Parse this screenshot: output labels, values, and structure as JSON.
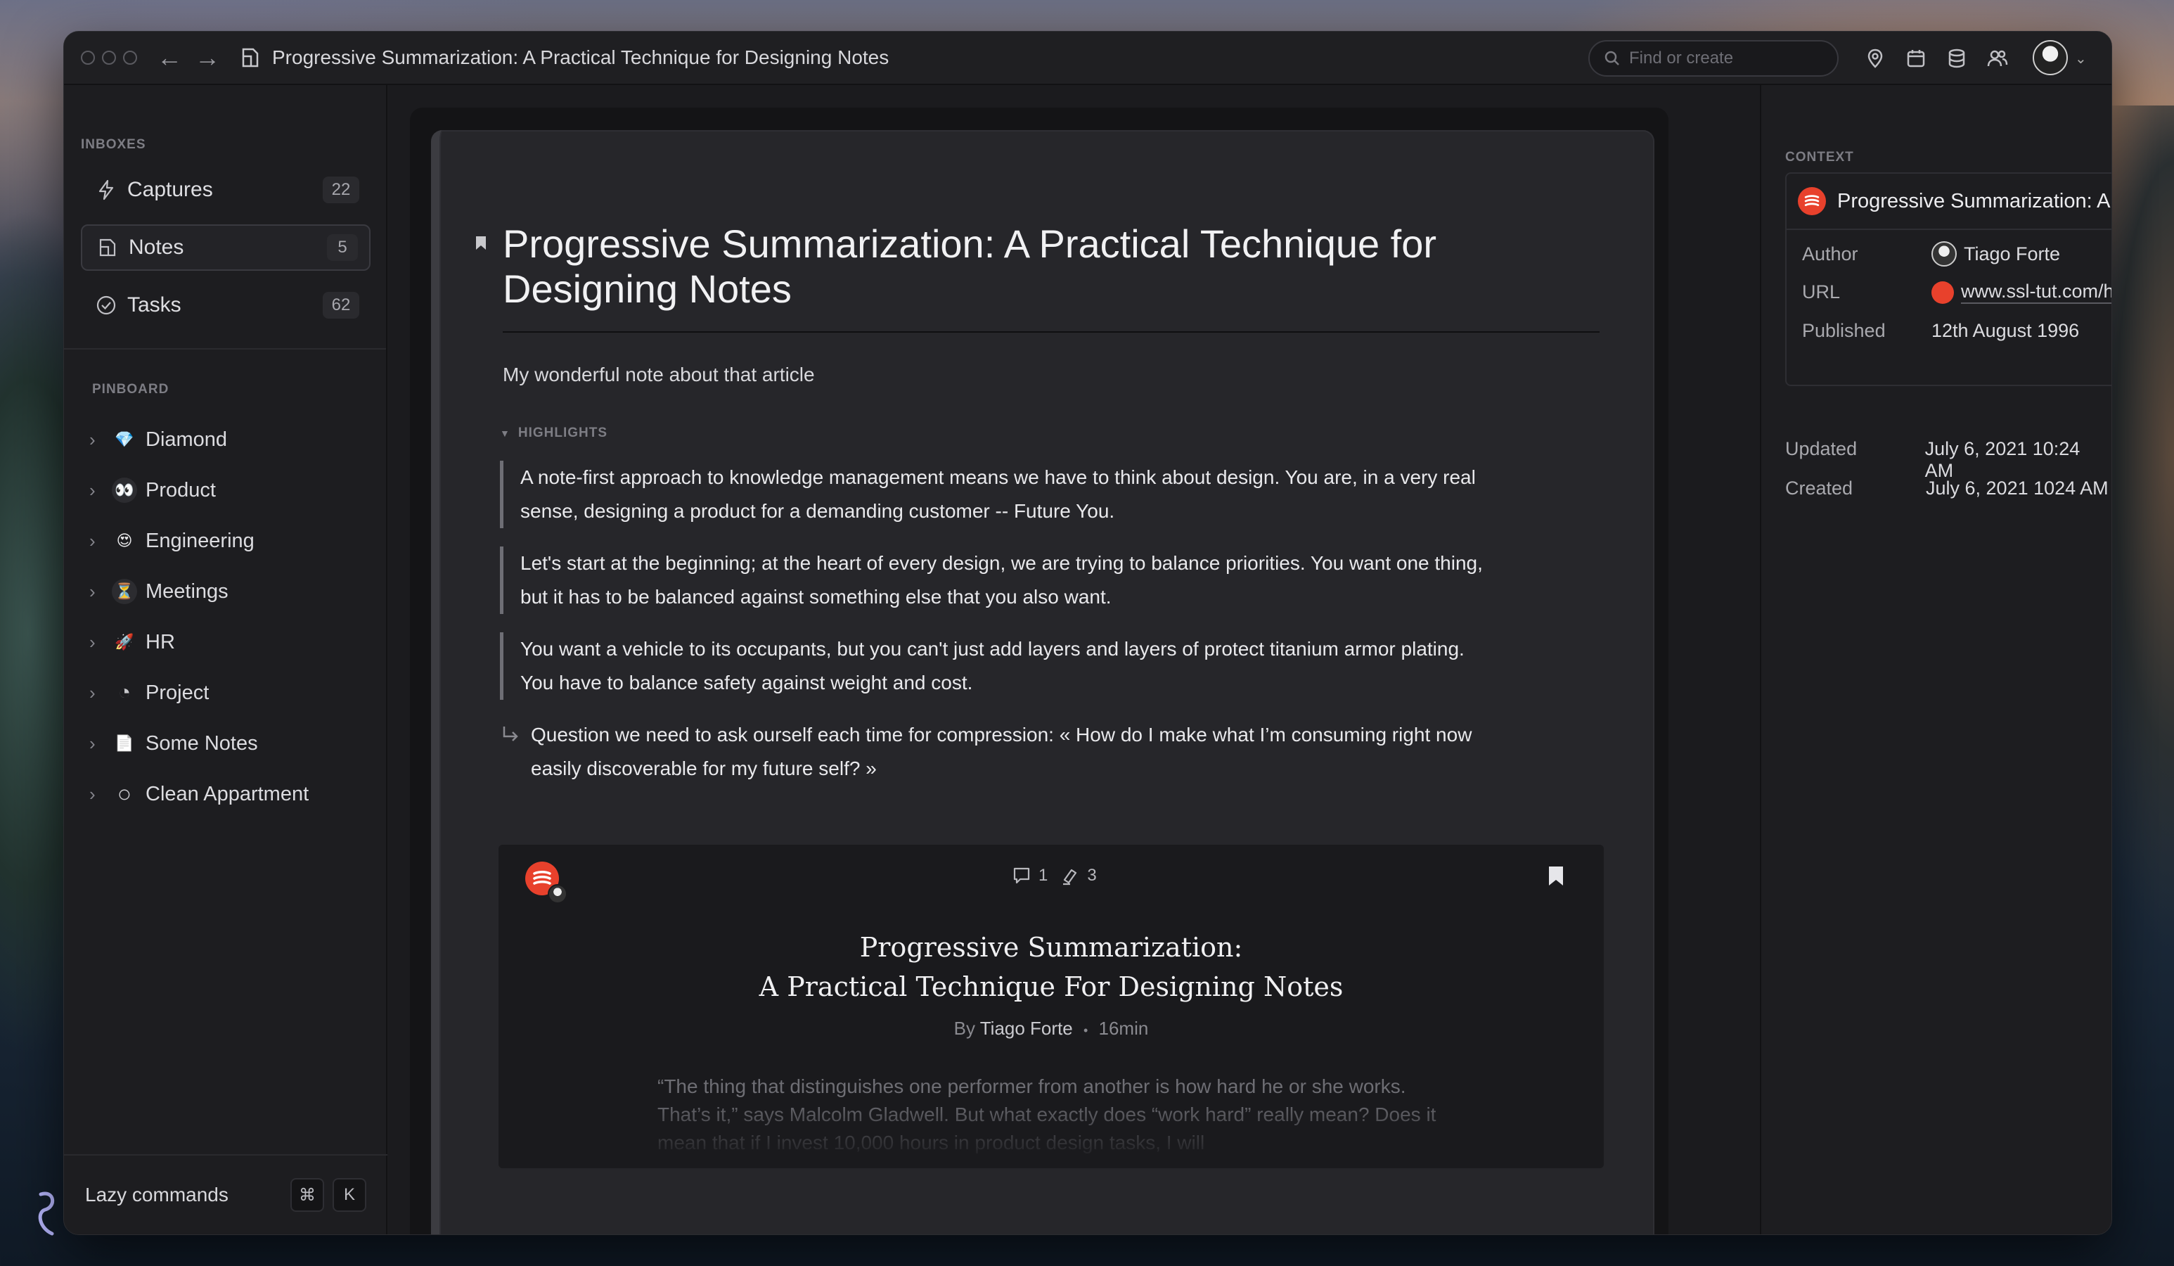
{
  "window": {
    "title": "Progressive Summarization: A Practical Technique for Designing Notes",
    "search_placeholder": "Find or create"
  },
  "toolbar_icons": [
    "location-pin-icon",
    "calendar-icon",
    "database-icon",
    "people-icon"
  ],
  "sidebar": {
    "inboxes_label": "INBOXES",
    "inboxes": [
      {
        "label": "Captures",
        "count": "22",
        "icon": "bolt-icon"
      },
      {
        "label": "Notes",
        "count": "5",
        "icon": "note-icon",
        "active": true
      },
      {
        "label": "Tasks",
        "count": "62",
        "icon": "check-circle-icon"
      }
    ],
    "pinboard_label": "PINBOARD",
    "pinboard": [
      {
        "label": "Diamond",
        "emoji": "💎"
      },
      {
        "label": "Product",
        "emoji": "👀"
      },
      {
        "label": "Engineering",
        "emoji": "😍"
      },
      {
        "label": "Meetings",
        "emoji": "⏳"
      },
      {
        "label": "HR",
        "emoji": "🚀"
      },
      {
        "label": "Project",
        "emoji": "◔"
      },
      {
        "label": "Some Notes",
        "emoji": "📄"
      },
      {
        "label": "Clean Appartment",
        "emoji": "○"
      }
    ],
    "lazy_commands": "Lazy commands",
    "shortcut_cmd": "⌘",
    "shortcut_key": "K"
  },
  "note": {
    "title": "Progressive Summarization: A Practical Technique for Designing Notes",
    "body": "My wonderful note about that article",
    "highlights_label": "HIGHLIGHTS",
    "highlights": [
      "A note-first approach to knowledge management means we have to think about design. You are, in a very real sense, designing a product for a demanding customer -- Future You.",
      "Let's start at the beginning; at the heart of every design, we are trying to balance priorities. You want one thing, but it has to be balanced against something else that you also want.",
      "You want a vehicle to its occupants, but you can't just add layers and layers of protect titanium armor plating. You have to balance safety against weight and cost."
    ],
    "followup": "Question we need to ask ourself each time for compression: « How do I make what I’m consuming right now easily discoverable for my future self? »"
  },
  "card": {
    "comments": "1",
    "highlights": "3",
    "title_line1": "Progressive Summarization:",
    "title_line2": "A Practical Technique For Designing Notes",
    "by": "By",
    "author": "Tiago Forte",
    "dot": "•",
    "read_time": "16min",
    "excerpt": "“The thing that distinguishes one performer from another is how hard he or she works. That’s it,” says Malcolm Gladwell. But what exactly does “work hard” really mean? Does it mean that if I invest 10,000 hours in product design tasks, I will"
  },
  "context": {
    "label": "CONTEXT",
    "source_name": "Progressive Summarization: A Practical Technique for Designing Notes",
    "author_label": "Author",
    "author": "Tiago Forte",
    "url_label": "URL",
    "url": "www.ssl-tut.com/how-to-progressive-summarization",
    "published_label": "Published",
    "published": "12th August 1996",
    "updated_label": "Updated",
    "updated": "July 6, 2021 10:24 AM",
    "created_label": "Created",
    "created": "July 6, 2021 1024 AM"
  },
  "colors": {
    "accent_red": "#e8412c",
    "background": "#1c1c1f"
  }
}
